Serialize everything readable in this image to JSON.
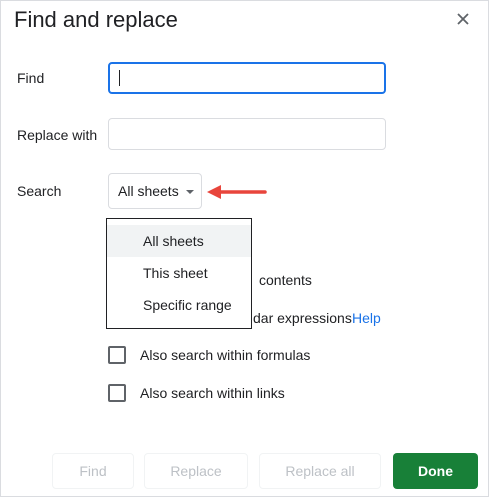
{
  "dialog": {
    "title": "Find and replace",
    "close_icon": "close-icon"
  },
  "find": {
    "label": "Find",
    "value": ""
  },
  "replace": {
    "label": "Replace with",
    "value": ""
  },
  "search": {
    "label": "Search",
    "selected": "All sheets",
    "options": [
      "All sheets",
      "This sheet",
      "Specific range"
    ],
    "highlighted_index": 0
  },
  "options": {
    "match_case_partial": "contents",
    "regex_partial": "dar expressions",
    "help_link": "Help",
    "within_formulas": "Also search within formulas",
    "within_links": "Also search within links"
  },
  "buttons": {
    "find": "Find",
    "replace": "Replace",
    "replace_all": "Replace all",
    "done": "Done"
  },
  "colors": {
    "accent": "#1a73e8",
    "done": "#188038",
    "arrow": "#e8453c"
  }
}
